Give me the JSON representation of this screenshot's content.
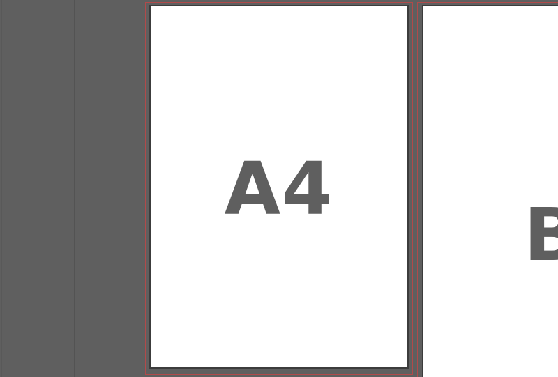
{
  "canvas": {
    "background_color": "#5f5f5f"
  },
  "artboards": [
    {
      "label": "A4",
      "fill_color": "#ffffff",
      "border_color": "#3c3c3c",
      "bleed_color": "#b14a4a"
    },
    {
      "label": "B",
      "fill_color": "#ffffff",
      "border_color": "#3c3c3c",
      "bleed_color": "#b14a4a"
    }
  ]
}
